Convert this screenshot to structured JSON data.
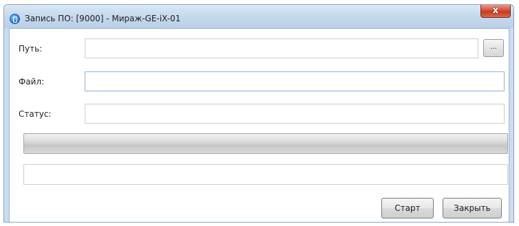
{
  "window": {
    "title": "Запись ПО: [9000] - Мираж-GE-iX-01",
    "close_label": "x"
  },
  "form": {
    "path_label": "Путь:",
    "path_value": "",
    "browse_label": "...",
    "file_label": "Файл:",
    "file_value": "",
    "status_label": "Статус:",
    "status_value": ""
  },
  "progress": {
    "value": 0
  },
  "log": {
    "text": ""
  },
  "buttons": {
    "start_label": "Старт",
    "close_label": "Закрыть"
  },
  "icons": {
    "app": "app-icon",
    "close": "close-icon"
  }
}
